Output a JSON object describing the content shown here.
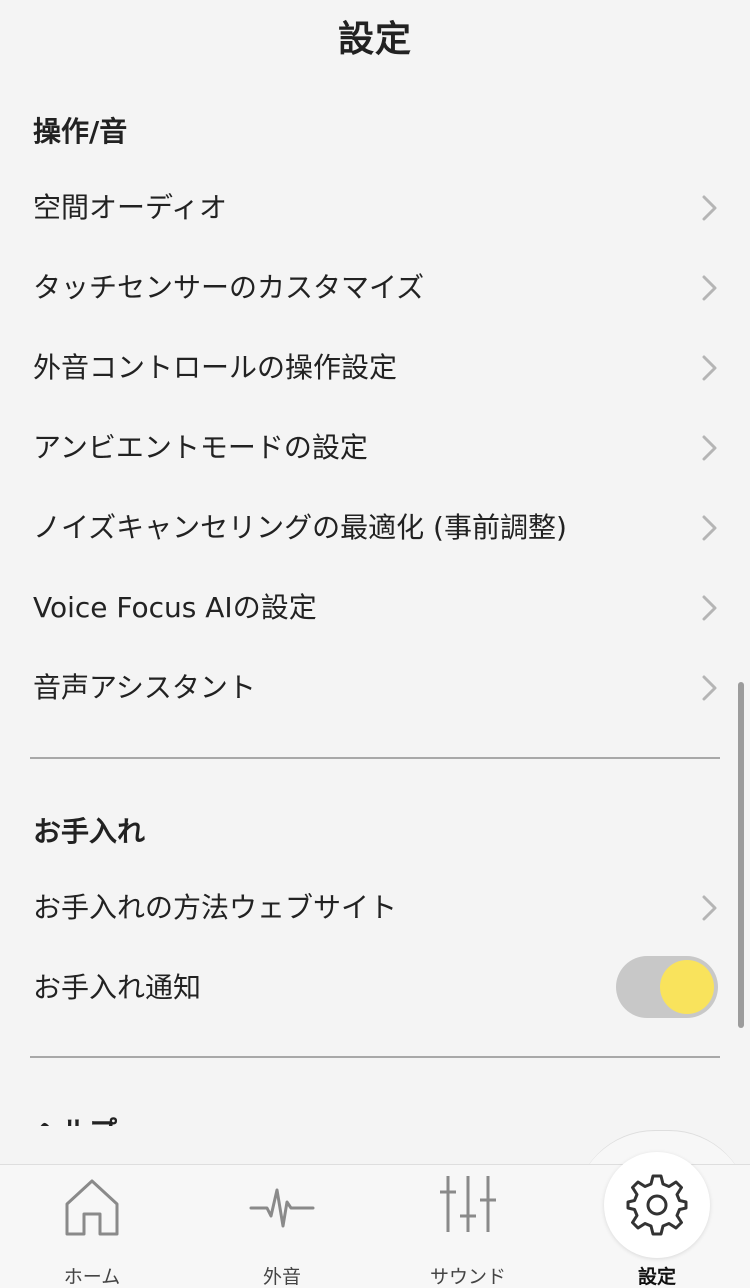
{
  "header": {
    "title": "設定"
  },
  "sections": {
    "controls": {
      "header": "操作/音",
      "items": [
        {
          "label": "空間オーディオ"
        },
        {
          "label": "タッチセンサーのカスタマイズ"
        },
        {
          "label": "外音コントロールの操作設定"
        },
        {
          "label": "アンビエントモードの設定"
        },
        {
          "label": "ノイズキャンセリングの最適化 (事前調整)"
        },
        {
          "label": "Voice Focus AIの設定"
        },
        {
          "label": "音声アシスタント"
        }
      ]
    },
    "care": {
      "header": "お手入れ",
      "items": [
        {
          "label": "お手入れの方法ウェブサイト"
        },
        {
          "label": "お手入れ通知",
          "toggle_on": true
        }
      ]
    },
    "help": {
      "header": "ヘルプ"
    }
  },
  "tabbar": {
    "tabs": [
      {
        "label": "ホーム",
        "icon": "home-icon"
      },
      {
        "label": "外音",
        "icon": "waveform-icon"
      },
      {
        "label": "サウンド",
        "icon": "equalizer-icon"
      },
      {
        "label": "設定",
        "icon": "gear-icon",
        "active": true
      }
    ]
  },
  "colors": {
    "background": "#f4f4f4",
    "toggle_track": "#c8c8c8",
    "toggle_knob": "#f9e35c",
    "divider": "#a8a8a8",
    "chevron": "#b5b5b5"
  }
}
